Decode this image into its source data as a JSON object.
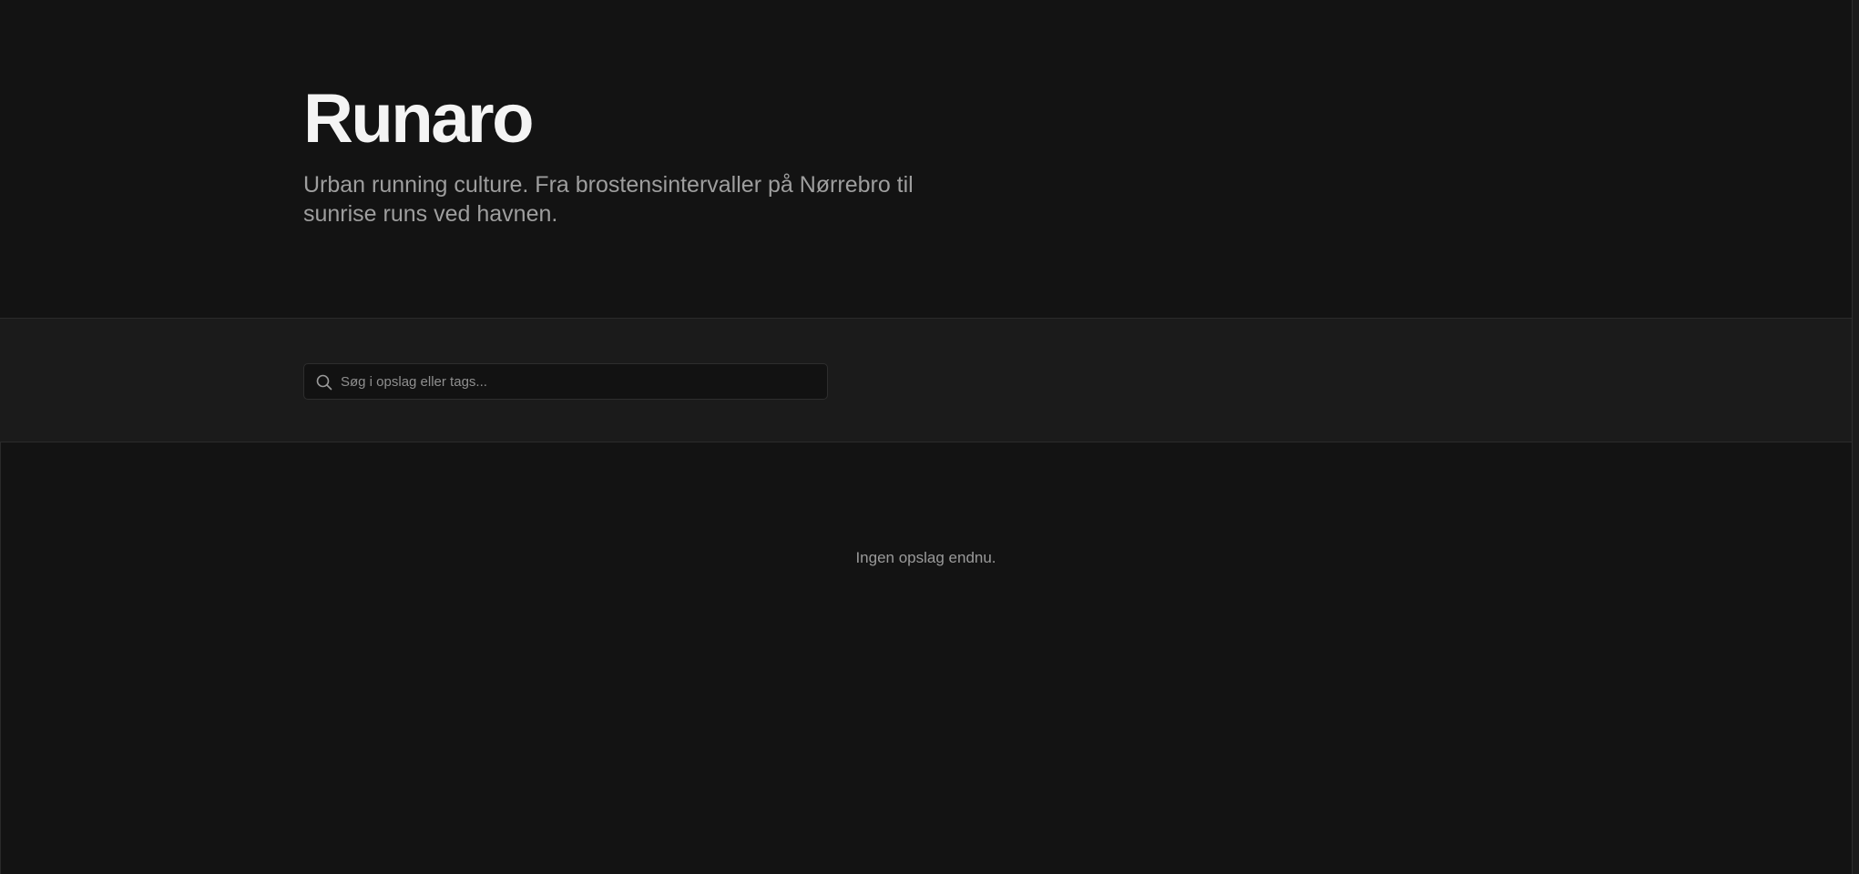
{
  "header": {
    "title": "Runaro",
    "tagline": "Urban running culture. Fra brostensintervaller på Nørrebro til sunrise runs ved havnen."
  },
  "search": {
    "icon": "search-icon",
    "placeholder": "Søg i opslag eller tags...",
    "value": ""
  },
  "posts": {
    "items": [],
    "empty_message": "Ingen opslag endnu."
  },
  "colors": {
    "background": "#131313",
    "band": "#1b1b1b",
    "title": "#f4f4f4",
    "muted_text": "#9e9e9e"
  }
}
